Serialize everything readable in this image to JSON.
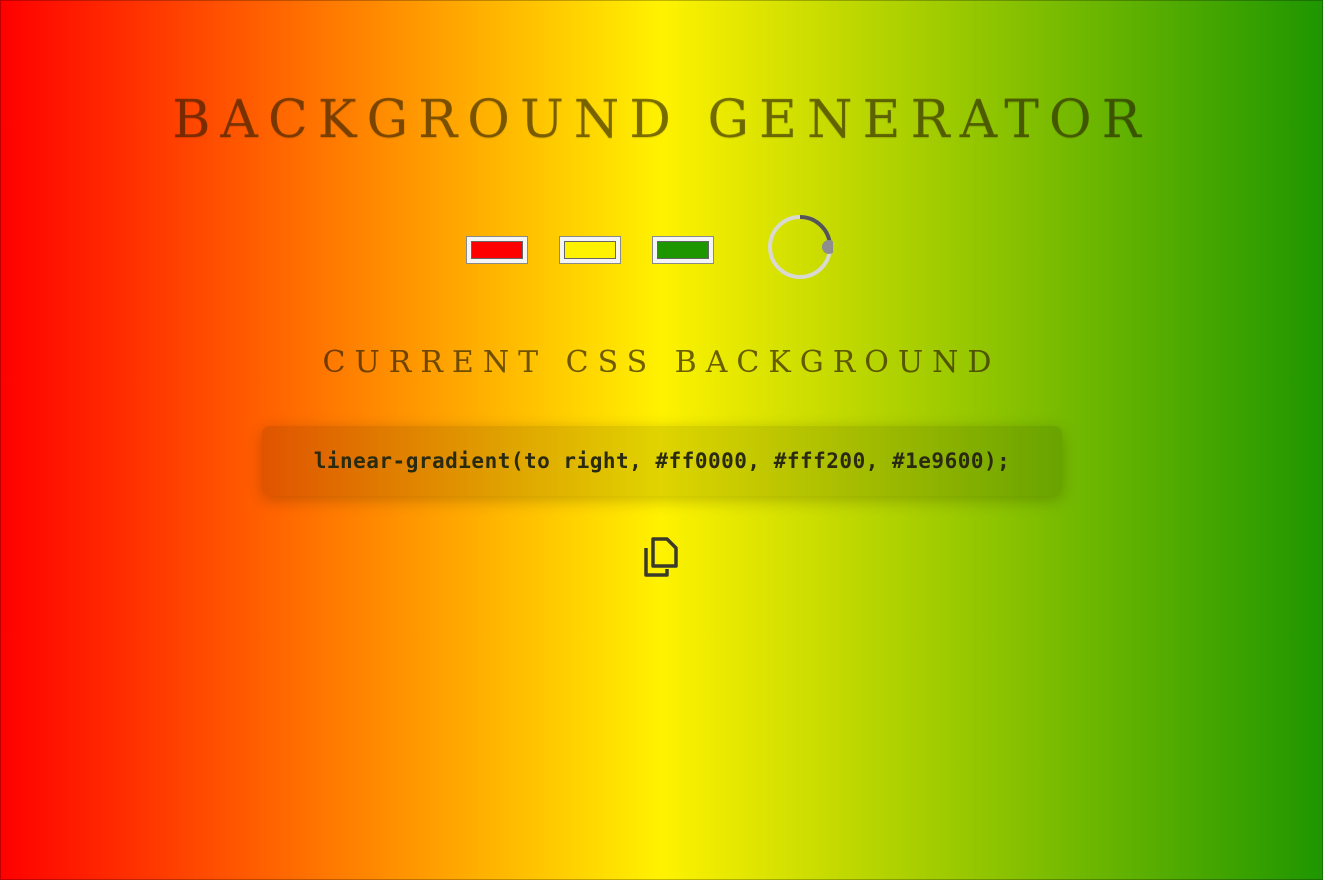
{
  "header": {
    "title": "BACKGROUND GENERATOR"
  },
  "colors": {
    "color1": "#ff0000",
    "color2": "#fff200",
    "color3": "#1e9600",
    "text": "#2a2a10"
  },
  "angle_knob": {
    "icon": "angle-dial",
    "value_fraction": 0.27
  },
  "section": {
    "subtitle": "CURRENT CSS BACKGROUND"
  },
  "css_output": {
    "value": "linear-gradient(to right, #ff0000, #fff200, #1e9600);"
  },
  "copy": {
    "icon": "copy-icon"
  }
}
